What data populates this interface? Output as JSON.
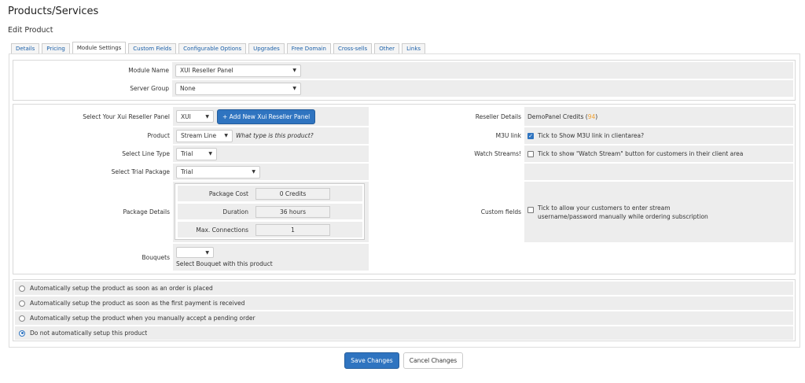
{
  "header": {
    "title": "Products/Services",
    "subtitle": "Edit Product"
  },
  "tabs": [
    {
      "label": "Details"
    },
    {
      "label": "Pricing"
    },
    {
      "label": "Module Settings"
    },
    {
      "label": "Custom Fields"
    },
    {
      "label": "Configurable Options"
    },
    {
      "label": "Upgrades"
    },
    {
      "label": "Free Domain"
    },
    {
      "label": "Cross-sells"
    },
    {
      "label": "Other"
    },
    {
      "label": "Links"
    }
  ],
  "module": {
    "module_name_label": "Module Name",
    "module_name_value": "XUI Reseller Panel",
    "server_group_label": "Server Group",
    "server_group_value": "None"
  },
  "settings": {
    "panel_label": "Select Your Xui Reseller Panel",
    "panel_value": "XUI",
    "add_panel_button": "+ Add New Xui Reseller Panel",
    "product_label": "Product",
    "product_value": "Stream Line",
    "product_hint": "What type is this product?",
    "line_type_label": "Select Line Type",
    "line_type_value": "Trial",
    "trial_package_label": "Select Trial Package",
    "trial_package_value": "Trial",
    "package_details_label": "Package Details",
    "package_cost_label": "Package Cost",
    "package_cost_value": "0 Credits",
    "duration_label": "Duration",
    "duration_value": "36 hours",
    "max_connections_label": "Max. Connections",
    "max_connections_value": "1",
    "bouquets_label": "Bouquets",
    "bouquets_hint": "Select Bouquet with this product",
    "reseller_details_label": "Reseller Details",
    "reseller_name": "DemoPanel Credits (",
    "reseller_credits": "94",
    "reseller_close": ")",
    "m3u_label": "M3U link",
    "m3u_text": "Tick to Show M3U link in clientarea?",
    "watch_label": "Watch Streams!",
    "watch_text": "Tick to show \"Watch Stream\" button for customers in their client area",
    "custom_fields_label": "Custom fields",
    "custom_fields_text_1": "Tick to allow your customers to enter stream",
    "custom_fields_text_2": "username/password manually while ordering subscription"
  },
  "setup_options": [
    {
      "label": "Automatically setup the product as soon as an order is placed"
    },
    {
      "label": "Automatically setup the product as soon as the first payment is received"
    },
    {
      "label": "Automatically setup the product when you manually accept a pending order"
    },
    {
      "label": "Do not automatically setup this product"
    }
  ],
  "actions": {
    "save": "Save Changes",
    "cancel": "Cancel Changes"
  },
  "colors": {
    "primary": "#2f74c0",
    "credits": "#f0a030",
    "field_bg": "#ededed"
  }
}
